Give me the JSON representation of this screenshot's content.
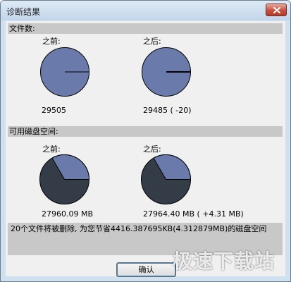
{
  "window": {
    "title": "诊断结果"
  },
  "files": {
    "header": "文件数:",
    "before_label": "之前:",
    "after_label": "之后:",
    "before_value": "29505",
    "after_value": "29485 ( -20)"
  },
  "disk": {
    "header": "可用磁盘空间:",
    "before_label": "之前:",
    "after_label": "之后:",
    "before_value": "27960.09 MB",
    "after_value": "27964.40 MB ( +4.31 MB)"
  },
  "summary": {
    "text": "20个文件将被删除, 为您节省4416.387695KB(4.312879MB)的磁盘空间"
  },
  "buttons": {
    "ok_label": "确认"
  },
  "watermark": {
    "text": "极速下载站"
  },
  "colors": {
    "pie_light": "#6a7aab",
    "pie_dark": "#343c48",
    "section_bg": "#c8c8c8"
  }
}
